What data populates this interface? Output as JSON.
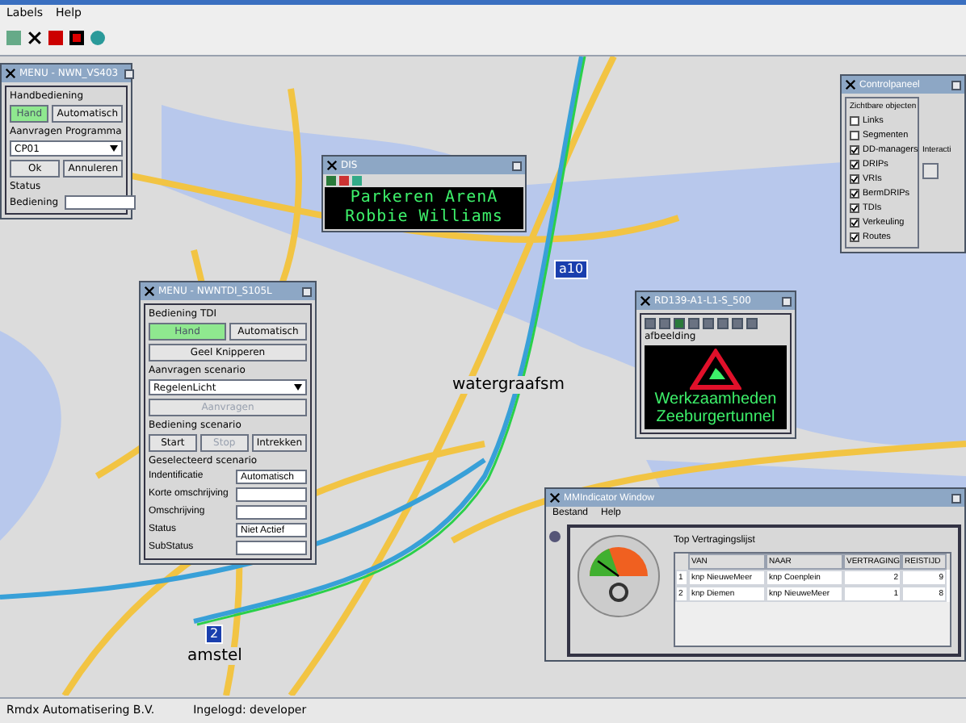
{
  "menu_bar": [
    "Labels",
    "Help"
  ],
  "map": {
    "labels": [
      {
        "text": "watergraafsm",
        "kind": "place"
      },
      {
        "text": "amstel",
        "kind": "place"
      },
      {
        "text": "a10",
        "kind": "shield"
      },
      {
        "text": "2",
        "kind": "shield"
      }
    ]
  },
  "windows": [
    {
      "kind": "menu_vri",
      "title": "MENU - NWN_VS403",
      "group1": "Handbediening",
      "buttons": [
        {
          "label": "Hand",
          "selected": true
        },
        {
          "label": "Automatisch",
          "selected": false
        }
      ],
      "group2": "Aanvragen Programma",
      "select": "CP01",
      "actions": [
        "Ok",
        "Annuleren"
      ],
      "group3": "Status",
      "fields": [
        {
          "label": "Bediening"
        }
      ]
    },
    {
      "kind": "control",
      "title": "Controlpaneel",
      "group1": "Zichtbare objecten",
      "checks": [
        {
          "label": "Links",
          "checked": false
        },
        {
          "label": "Segmenten",
          "checked": false
        },
        {
          "label": "DD-managers",
          "checked": true
        },
        {
          "label": "DRIPs",
          "checked": true
        },
        {
          "label": "VRIs",
          "checked": true
        },
        {
          "label": "BermDRIPs",
          "checked": true
        },
        {
          "label": "TDIs",
          "checked": true
        },
        {
          "label": "Verkeuling",
          "checked": true
        },
        {
          "label": "Routes",
          "checked": true
        }
      ],
      "group2": "Interacti"
    },
    {
      "kind": "dis",
      "title": "DIS",
      "lines": [
        "Parkeren ArenA",
        "Robbie Williams"
      ]
    },
    {
      "kind": "menu_tdi",
      "title": "MENU - NWNTDI_S105L",
      "group1": "Bediening TDI",
      "buttons": [
        {
          "label": "Hand",
          "selected": true
        },
        {
          "label": "Automatisch",
          "selected": false
        }
      ],
      "blink": "Geel Knipperen",
      "group2": "Aanvragen scenario",
      "select": "RegelenLicht",
      "request": {
        "label": "Aanvragen",
        "disabled": true
      },
      "group3": "Bediening scenario",
      "controls": [
        {
          "label": "Start",
          "disabled": false
        },
        {
          "label": "Stop",
          "disabled": true
        },
        {
          "label": "Intrekken",
          "disabled": false
        }
      ],
      "group4": "Geselecteerd scenario",
      "fields": [
        {
          "label": "Indentificatie",
          "value": "Automatisch"
        },
        {
          "label": "Korte omschrijving"
        },
        {
          "label": "Omschrijving"
        },
        {
          "label": "Status",
          "value": "Niet Actief"
        },
        {
          "label": "SubStatus"
        }
      ]
    },
    {
      "kind": "drip",
      "title": "RD139-A1-L1-S_500",
      "caption": "afbeelding",
      "lines": [
        "Werkzaamheden",
        "Zeeburgertunnel"
      ]
    },
    {
      "kind": "mmi",
      "title": "MMIndicator Window",
      "menu": [
        "Bestand",
        "Help"
      ],
      "list_title": "Top Vertragingslijst",
      "columns": [
        "VAN",
        "NAAR",
        "VERTRAGING",
        "REISTIJD"
      ],
      "rows": [
        {
          "index": "1",
          "cells": [
            "knp NieuweMeer",
            "knp Coenplein",
            "2",
            "9"
          ]
        },
        {
          "index": "2",
          "cells": [
            "knp Diemen",
            "knp NieuweMeer",
            "1",
            "8"
          ]
        }
      ],
      "gauge": {
        "level": 0.2
      }
    }
  ],
  "status_bar": [
    "Rmdx Automatisering B.V.",
    "Ingelogd: developer"
  ]
}
